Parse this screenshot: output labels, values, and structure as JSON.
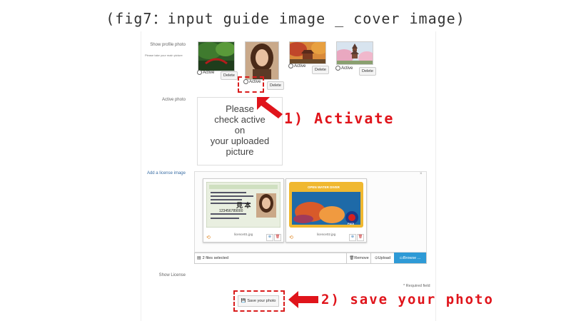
{
  "figure_title": "(fig7：input guide image _ cover image)",
  "form": {
    "show_profile_photo_label": "Show profile photo",
    "profile_hint": "Please take your main picture",
    "active_photo_label": "Active photo",
    "placeholder_lines": [
      "Please",
      "check active",
      "on",
      "your uploaded",
      "picture"
    ],
    "add_license_label": "Add a license image",
    "show_license_label": "Show License",
    "required_field": "* Required field",
    "save_label": "Save your photo"
  },
  "profile_photos": [
    {
      "radio_label": "Active",
      "delete_label": "Delete",
      "scene": "garden"
    },
    {
      "radio_label": "Active",
      "delete_label": "Delete",
      "scene": "portrait"
    },
    {
      "radio_label": "Active",
      "delete_label": "Delete",
      "scene": "autumn-temple"
    },
    {
      "radio_label": "Active",
      "delete_label": "Delete",
      "scene": "pagoda"
    }
  ],
  "license_files": [
    {
      "filename": "licence01.jpg"
    },
    {
      "filename": "licence02.jpg",
      "card_title": "OPEN WATER DIVER",
      "badge": "PADI"
    }
  ],
  "license_card1_text": [
    "見 本",
    "123456789000"
  ],
  "file_bar": {
    "status": "2 files selected",
    "remove_label": "Remove",
    "upload_label": "Upload",
    "browse_label": "Browse ..."
  },
  "annotations": {
    "step1": "1) Activate",
    "step2": "2) save your photo"
  },
  "colors": {
    "annotation_red": "#e0141b",
    "browse_blue": "#2e9ad6",
    "link_blue": "#3a6ea5"
  }
}
